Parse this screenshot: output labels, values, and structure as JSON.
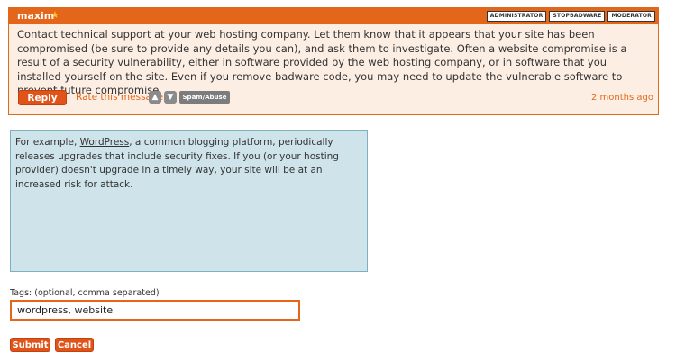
{
  "post": {
    "author": "maxim",
    "badges": [
      "ADMINISTRATOR",
      "STOPBADWARE",
      "MODERATOR"
    ],
    "body": "Contact technical support at your web hosting company. Let them know that it appears that your site has been compromised (be sure to provide any details you can), and ask them to investigate. Often a website compromise is a result of a security vulnerability, either in software provided by the web hosting company, or in software that you installed yourself on the site. Even if you remove badware code, you may need to update the vulnerable software to prevent future compromise.",
    "reply_label": "Reply",
    "rate_label": "Rate this message:",
    "spam_label": "Spam/Abuse",
    "time": "2 months ago"
  },
  "composer": {
    "text_before": "For example, ",
    "link_word": "WordPress",
    "text_after": ", a common blogging platform, periodically releases upgrades that include security fixes. If you (or your hosting provider) doesn't upgrade in a timely way, your site will be at an increased risk for attack."
  },
  "tags": {
    "label": "Tags: (optional, comma separated)",
    "value": "wordpress, website"
  },
  "actions": {
    "submit": "Submit",
    "cancel": "Cancel"
  },
  "colors": {
    "accent": "#e3661a",
    "post_bg": "#fdeee3",
    "composer_bg": "#cfe3ea"
  }
}
